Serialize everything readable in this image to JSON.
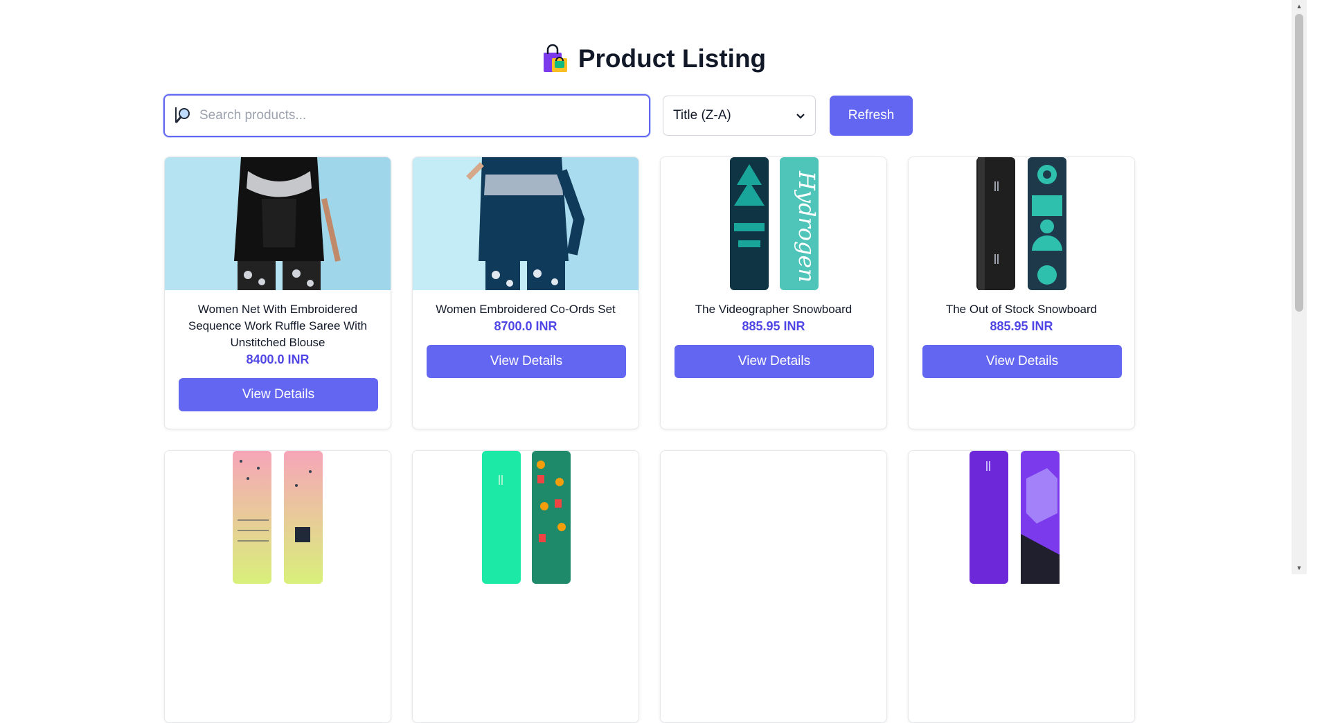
{
  "header": {
    "title": "Product Listing",
    "icon": "shopping-bags-icon"
  },
  "search": {
    "placeholder": "Search products...",
    "value": "",
    "icon": "magnifier-icon"
  },
  "sort": {
    "selected": "Title (Z-A)",
    "icon": "chevron-down-icon"
  },
  "refresh_label": "Refresh",
  "colors": {
    "accent": "#6366f1",
    "price": "#4f46e5",
    "focus_border": "#6366f1"
  },
  "products": [
    {
      "title": "Women Net With Embroidered Sequence Work Ruffle Saree With Unstitched Blouse",
      "price": "8400.0 INR",
      "button": "View Details"
    },
    {
      "title": "Women Embroidered Co-Ords Set",
      "price": "8700.0 INR",
      "button": "View Details"
    },
    {
      "title": "The Videographer Snowboard",
      "price": "885.95 INR",
      "button": "View Details"
    },
    {
      "title": "The Out of Stock Snowboard",
      "price": "885.95 INR",
      "button": "View Details"
    },
    {
      "title": "",
      "price": "",
      "button": ""
    },
    {
      "title": "",
      "price": "",
      "button": ""
    },
    {
      "title": "",
      "price": "",
      "button": ""
    },
    {
      "title": "",
      "price": "",
      "button": ""
    }
  ]
}
